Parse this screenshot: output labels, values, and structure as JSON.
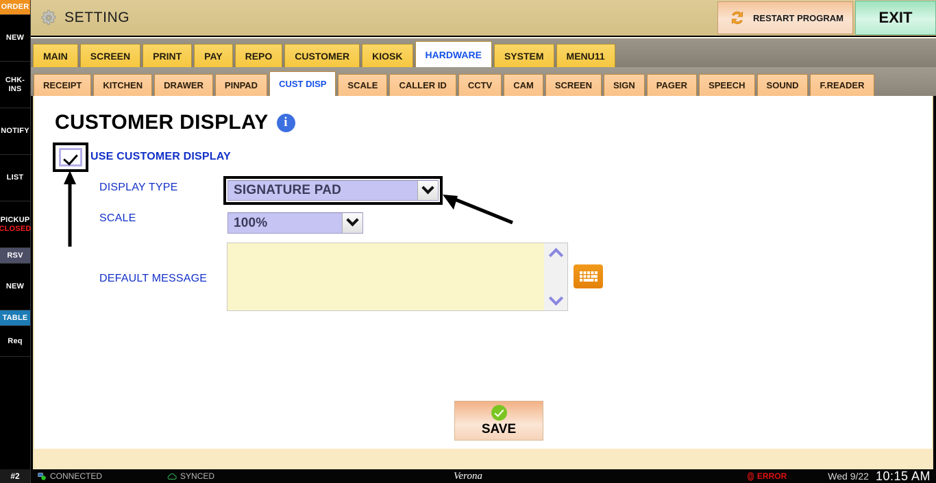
{
  "sidebar": {
    "items": [
      {
        "label": "ORDER",
        "style": "order"
      },
      {
        "label": "NEW",
        "style": "plain"
      },
      {
        "label": "CHK-INS",
        "style": "plain"
      },
      {
        "label": "NOTIFY",
        "style": "plain"
      },
      {
        "label": "LIST",
        "style": "plain"
      },
      {
        "label": "PICKUP",
        "sublabel": "CLOSED",
        "style": "plain"
      },
      {
        "label": "RSV",
        "style": "rsv"
      },
      {
        "label": "NEW",
        "style": "plain"
      },
      {
        "label": "TABLE",
        "style": "table"
      },
      {
        "label": "Req",
        "style": "plain"
      }
    ]
  },
  "header": {
    "title": "SETTING",
    "gear_icon": "gear-icon",
    "restart_label": "RESTART PROGRAM",
    "restart_icon": "refresh-icon",
    "exit_label": "EXIT"
  },
  "tabs": [
    {
      "label": "MAIN",
      "active": false
    },
    {
      "label": "SCREEN",
      "active": false
    },
    {
      "label": "PRINT",
      "active": false
    },
    {
      "label": "PAY",
      "active": false
    },
    {
      "label": "REPO",
      "active": false
    },
    {
      "label": "CUSTOMER",
      "active": false
    },
    {
      "label": "KIOSK",
      "active": false
    },
    {
      "label": "HARDWARE",
      "active": true
    },
    {
      "label": "SYSTEM",
      "active": false
    },
    {
      "label": "MENU11",
      "active": false
    }
  ],
  "subtabs": [
    {
      "label": "RECEIPT",
      "active": false
    },
    {
      "label": "KITCHEN",
      "active": false
    },
    {
      "label": "DRAWER",
      "active": false
    },
    {
      "label": "PINPAD",
      "active": false
    },
    {
      "label": "CUST DISP",
      "active": true
    },
    {
      "label": "SCALE",
      "active": false
    },
    {
      "label": "CALLER ID",
      "active": false
    },
    {
      "label": "CCTV",
      "active": false
    },
    {
      "label": "CAM",
      "active": false
    },
    {
      "label": "SCREEN",
      "active": false
    },
    {
      "label": "SIGN",
      "active": false
    },
    {
      "label": "PAGER",
      "active": false
    },
    {
      "label": "SPEECH",
      "active": false
    },
    {
      "label": "SOUND",
      "active": false
    },
    {
      "label": "F.READER",
      "active": false
    }
  ],
  "main": {
    "page_title": "CUSTOMER DISPLAY",
    "info_icon": "info-icon",
    "use_customer_display": {
      "label": "USE CUSTOMER DISPLAY",
      "checked": true
    },
    "display_type": {
      "label": "DISPLAY TYPE",
      "value": "SIGNATURE PAD"
    },
    "scale": {
      "label": "SCALE",
      "value": "100%"
    },
    "default_message": {
      "label": "DEFAULT MESSAGE",
      "value": "",
      "placeholder": ""
    },
    "keyboard_button_icon": "keyboard-icon",
    "save_label": "SAVE"
  },
  "status": {
    "terminal": "#2",
    "connected": "CONNECTED",
    "synced": "SYNCED",
    "brand": "Verona",
    "error": "ERROR",
    "date": "Wed 9/22",
    "time": "10:15 AM"
  },
  "colors": {
    "accent_blue": "#1230c7",
    "active_tab_text": "#1450e8",
    "header_bg": "#d9c68f",
    "tab_bg": "#f6c73f",
    "subtab_bg": "#fac288",
    "select_bg": "#c6c4f2",
    "textarea_bg": "#fbf6c9",
    "error_red": "#e01010",
    "sidebar_order": "#f0901e",
    "keyboard_orange": "#e4820b",
    "save_green": "#7ac522"
  }
}
